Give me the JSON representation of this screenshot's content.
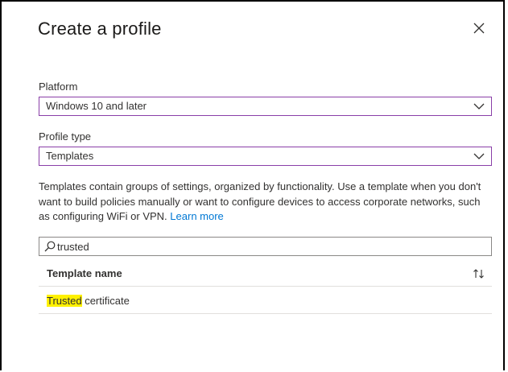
{
  "dialog": {
    "title": "Create a profile"
  },
  "platform": {
    "label": "Platform",
    "value": "Windows 10 and later"
  },
  "profile_type": {
    "label": "Profile type",
    "value": "Templates"
  },
  "description": {
    "text": "Templates contain groups of settings, organized by functionality. Use a template when you don't want to build policies manually or want to configure devices to access corporate networks, such as configuring WiFi or VPN.",
    "link": "Learn more"
  },
  "search": {
    "value": "trusted",
    "placeholder": ""
  },
  "table": {
    "column_header": "Template name",
    "rows": [
      {
        "highlight": "Trusted",
        "rest": " certificate"
      }
    ]
  },
  "colors": {
    "accent_border": "#8a3fa8",
    "link": "#0078d4",
    "highlight": "#fff100"
  },
  "icons": {
    "close": "close-icon",
    "chevron": "chevron-down-icon",
    "search": "search-icon",
    "sort": "sort-icon"
  }
}
